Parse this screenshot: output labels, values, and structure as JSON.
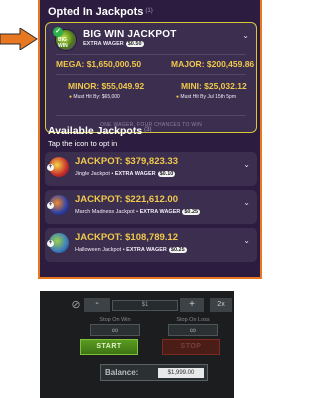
{
  "opted": {
    "title": "Opted In Jackpots",
    "count": "(1)",
    "card": {
      "badge_text": "BIG WIN",
      "name": "BIG WIN JACKPOT",
      "wager_label": "EXTRA WAGER",
      "wager_value": "$0.50",
      "mega": "MEGA: $1,650,000.50",
      "major": "MAJOR: $200,459.86",
      "minor": "MINOR: $55,049.92",
      "minor_note": "Must Hit By: $65,000",
      "mini": "MINI: $25,032.12",
      "mini_note": "Must Hit By Jul 15th 5pm",
      "footer": "ONE WAGER, FOUR CHANCES TO WIN"
    }
  },
  "available": {
    "title": "Available Jackpots",
    "count": "(3)",
    "subtitle": "Tap the icon to opt in",
    "items": [
      {
        "amount": "JACKPOT: $379,823.33",
        "name": "Jingle Jackpot",
        "wager_label": "EXTRA WAGER",
        "wager_value": "$0.10",
        "icon_color": "#c62c2c"
      },
      {
        "amount": "JACKPOT: $221,612.00",
        "name": "March Madness Jackpot",
        "wager_label": "EXTRA WAGER",
        "wager_value": "$0.25",
        "icon_color": "#2a3fa8"
      },
      {
        "amount": "JACKPOT: $108,789.12",
        "name": "Halloween Jackpot",
        "wager_label": "EXTRA WAGER",
        "wager_value": "$0.25",
        "icon_color": "#3a7bbf"
      }
    ]
  },
  "controls": {
    "stake": "$1",
    "minus": "-",
    "plus": "+",
    "double": "2x",
    "stop_on_win_label": "Stop On Win",
    "stop_on_win_value": "∞",
    "stop_on_loss_label": "Stop On Loss",
    "stop_on_loss_value": "∞",
    "start": "START",
    "stop": "STOP",
    "balance_label": "Balance:",
    "balance_value": "$1,999.00"
  },
  "colors": {
    "panel_border": "#e87722",
    "jackpot_gold": "#f2c94c",
    "arrow": "#e87722",
    "start_green": "#4e8a1c"
  }
}
